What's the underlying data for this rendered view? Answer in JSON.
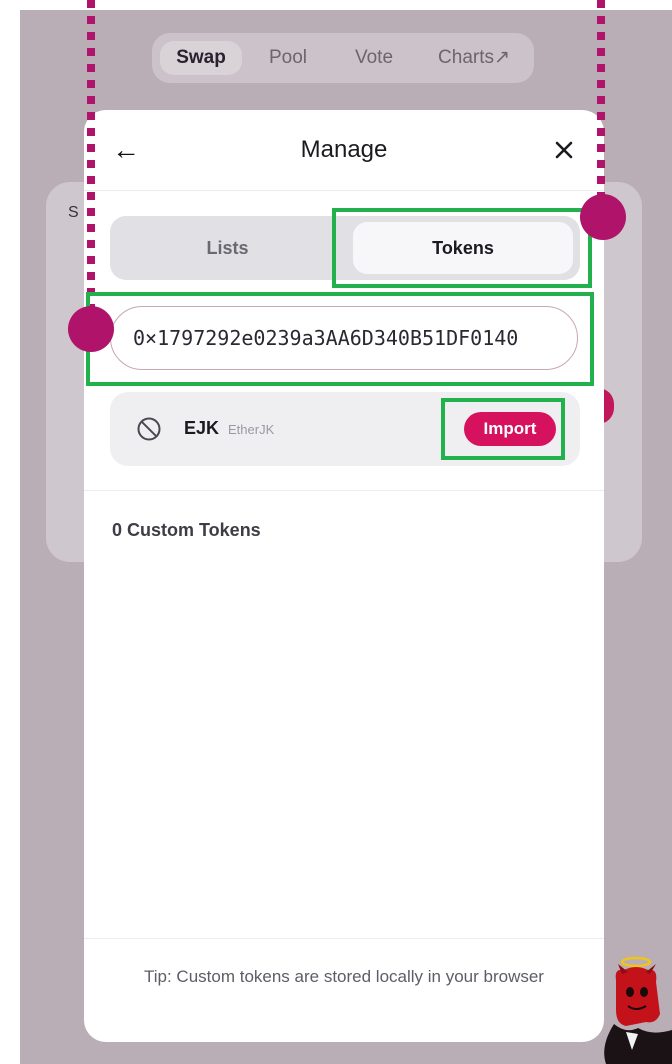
{
  "top_nav": {
    "items": [
      {
        "label": "Swap",
        "active": true
      },
      {
        "label": "Pool",
        "active": false
      },
      {
        "label": "Vote",
        "active": false
      },
      {
        "label": "Charts↗",
        "active": false
      }
    ]
  },
  "background_card": {
    "letter": "S"
  },
  "modal": {
    "title": "Manage",
    "back_icon": "arrow-left-icon",
    "close_icon": "close-icon",
    "tabs": [
      {
        "label": "Lists",
        "active": false
      },
      {
        "label": "Tokens",
        "active": true
      }
    ],
    "search": {
      "value": "0×1797292e0239a3AA6D340B51DF0140",
      "placeholder": ""
    },
    "token_result": {
      "icon": "block-icon",
      "symbol": "EJK",
      "name": "EtherJK",
      "import_label": "Import"
    },
    "custom_tokens_label": "0 Custom Tokens",
    "tip": "Tip: Custom tokens are stored locally in your browser"
  },
  "colors": {
    "accent": "#d6125f",
    "annotation_box": "#22b14c",
    "annotation_dot": "#b0136a",
    "backdrop": "#b9aeb6"
  }
}
